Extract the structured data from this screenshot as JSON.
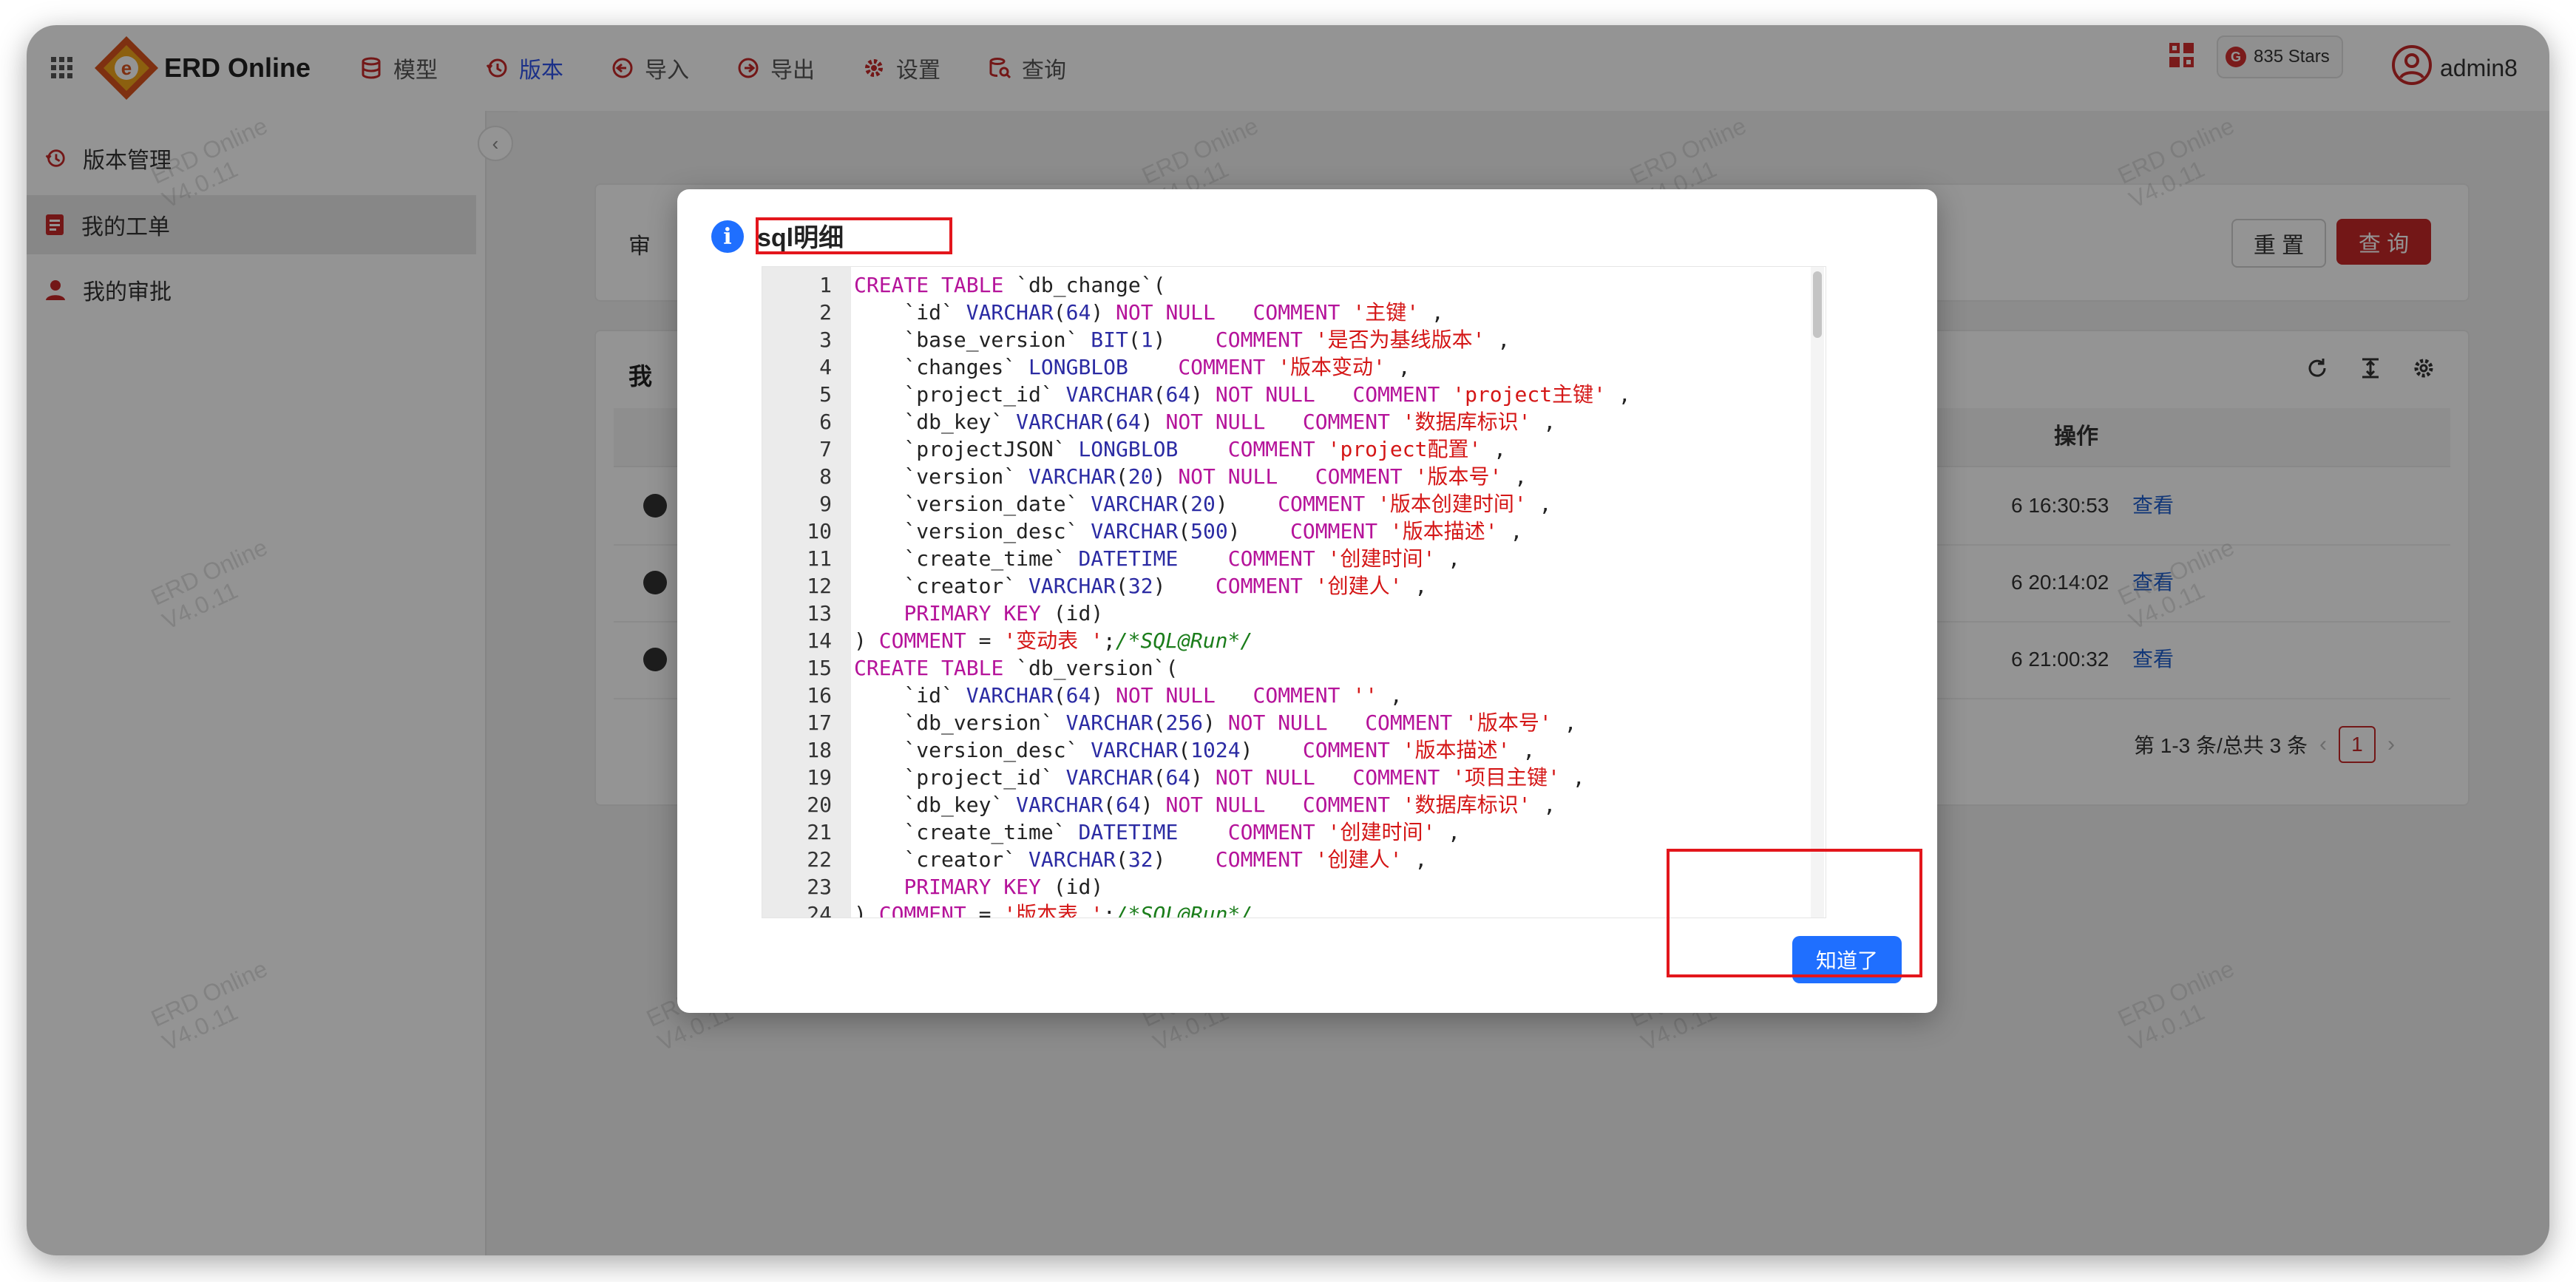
{
  "header": {
    "app_title": "ERD Online",
    "nav": [
      {
        "label": "模型",
        "icon": "database-icon"
      },
      {
        "label": "版本",
        "icon": "history-icon"
      },
      {
        "label": "导入",
        "icon": "import-icon"
      },
      {
        "label": "导出",
        "icon": "export-icon"
      },
      {
        "label": "设置",
        "icon": "gear-icon"
      },
      {
        "label": "查询",
        "icon": "query-icon"
      }
    ],
    "active_nav": "版本",
    "stars": "835 Stars",
    "username": "admin8"
  },
  "sidebar": {
    "items": [
      {
        "label": "版本管理",
        "icon": "history-icon"
      },
      {
        "label": "我的工单",
        "icon": "ticket-icon"
      },
      {
        "label": "我的审批",
        "icon": "user-icon"
      }
    ],
    "active_item": "我的工单"
  },
  "search": {
    "label": "审",
    "reset_label": "重 置",
    "query_label": "查 询"
  },
  "table": {
    "title": "我",
    "op_header": "操作",
    "rows": [
      {
        "time": "6 16:30:53",
        "action": "查看"
      },
      {
        "time": "6 20:14:02",
        "action": "查看"
      },
      {
        "time": "6 21:00:32",
        "action": "查看"
      }
    ],
    "pagination_text": "第 1-3 条/总共 3 条",
    "current_page": "1"
  },
  "watermark": {
    "line1": "ERD Online",
    "line2": "V4.0.11"
  },
  "modal": {
    "title": "sql明细",
    "ok_label": "知道了",
    "code_lines": [
      "CREATE TABLE `db_change`(",
      "    `id` VARCHAR(64) NOT NULL   COMMENT '主键' ,",
      "    `base_version` BIT(1)    COMMENT '是否为基线版本' ,",
      "    `changes` LONGBLOB    COMMENT '版本变动' ,",
      "    `project_id` VARCHAR(64) NOT NULL   COMMENT 'project主键' ,",
      "    `db_key` VARCHAR(64) NOT NULL   COMMENT '数据库标识' ,",
      "    `projectJSON` LONGBLOB    COMMENT 'project配置' ,",
      "    `version` VARCHAR(20) NOT NULL   COMMENT '版本号' ,",
      "    `version_date` VARCHAR(20)    COMMENT '版本创建时间' ,",
      "    `version_desc` VARCHAR(500)    COMMENT '版本描述' ,",
      "    `create_time` DATETIME    COMMENT '创建时间' ,",
      "    `creator` VARCHAR(32)    COMMENT '创建人' ,",
      "    PRIMARY KEY (id)",
      ") COMMENT = '变动表 ';/*SQL@Run*/",
      "CREATE TABLE `db_version`(",
      "    `id` VARCHAR(64) NOT NULL   COMMENT '' ,",
      "    `db_version` VARCHAR(256) NOT NULL   COMMENT '版本号' ,",
      "    `version_desc` VARCHAR(1024)    COMMENT '版本描述' ,",
      "    `project_id` VARCHAR(64) NOT NULL   COMMENT '项目主键' ,",
      "    `db_key` VARCHAR(64) NOT NULL   COMMENT '数据库标识' ,",
      "    `create_time` DATETIME    COMMENT '创建时间' ,",
      "    `creator` VARCHAR(32)    COMMENT '创建人' ,",
      "    PRIMARY KEY (id)",
      ") COMMENT = '版本表 ';/*SQL@Run*/"
    ]
  },
  "colors": {
    "accent_blue": "#1f6fff",
    "nav_active": "#2f54eb",
    "brand_red": "#c62828",
    "highlight_box": "#e3161c"
  }
}
